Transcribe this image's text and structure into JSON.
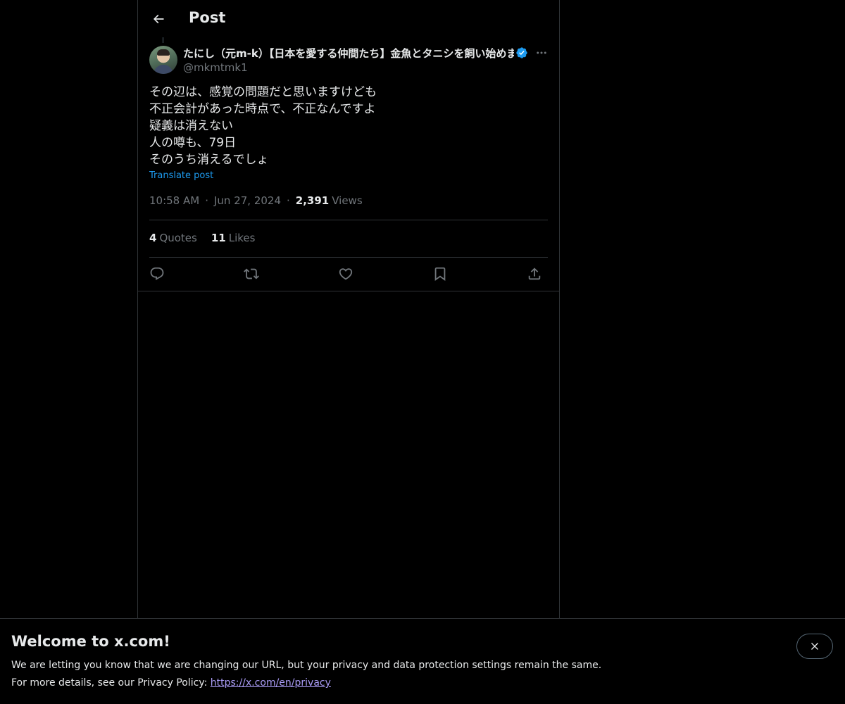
{
  "header": {
    "title": "Post",
    "back_icon": "arrow-left-icon"
  },
  "author": {
    "display_name": "たにし（元m-k）【日本を愛する仲間たち】金魚とタニシを飼い始めました",
    "handle": "@mkmtmk1",
    "verified": true,
    "verified_color": "#1d9bf0"
  },
  "post": {
    "lines": [
      "その辺は、感覚の問題だと思いますけども",
      "不正会計があった時点で、不正なんですよ",
      "疑義は消えない",
      "人の噂も、79日",
      "そのうち消えるでしょ"
    ],
    "translate_label": "Translate post",
    "time": "10:58 AM",
    "separator": "·",
    "date": "Jun 27, 2024",
    "views_count": "2,391",
    "views_label": "Views"
  },
  "stats": {
    "quotes_count": "4",
    "quotes_label": "Quotes",
    "likes_count": "11",
    "likes_label": "Likes"
  },
  "actions": [
    {
      "icon": "reply-icon"
    },
    {
      "icon": "repost-icon"
    },
    {
      "icon": "like-icon"
    },
    {
      "icon": "bookmark-icon"
    },
    {
      "icon": "share-icon"
    }
  ],
  "banner": {
    "title": "Welcome to x.com!",
    "line1": "We are letting you know that we are changing our URL, but your privacy and data protection settings remain the same.",
    "line2_prefix": "For more details, see our Privacy Policy: ",
    "link_text": "https://x.com/en/privacy",
    "close_icon": "close-icon"
  },
  "colors": {
    "background": "#000000",
    "text_primary": "#e7e9ea",
    "text_secondary": "#71767b",
    "accent": "#1d9bf0",
    "border": "#2f3336",
    "link": "#a99bf5"
  }
}
